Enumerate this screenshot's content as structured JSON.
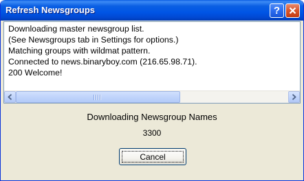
{
  "window": {
    "title": "Refresh Newsgroups",
    "help_glyph": "?",
    "close_icon": "close-icon"
  },
  "log": {
    "lines": [
      "Downloading master newsgroup list.",
      "(See Newsgroups tab in Settings for options.)",
      "Matching groups with wildmat pattern.",
      "Connected to news.binaryboy.com (216.65.98.71).",
      "200 Welcome!"
    ]
  },
  "status": {
    "title": "Downloading Newsgroup Names",
    "count": "3300"
  },
  "buttons": {
    "cancel_label": "Cancel"
  },
  "colors": {
    "titlebar": "#0055e5",
    "dialog_bg": "#ece9d8",
    "close_button": "#d9552a"
  }
}
